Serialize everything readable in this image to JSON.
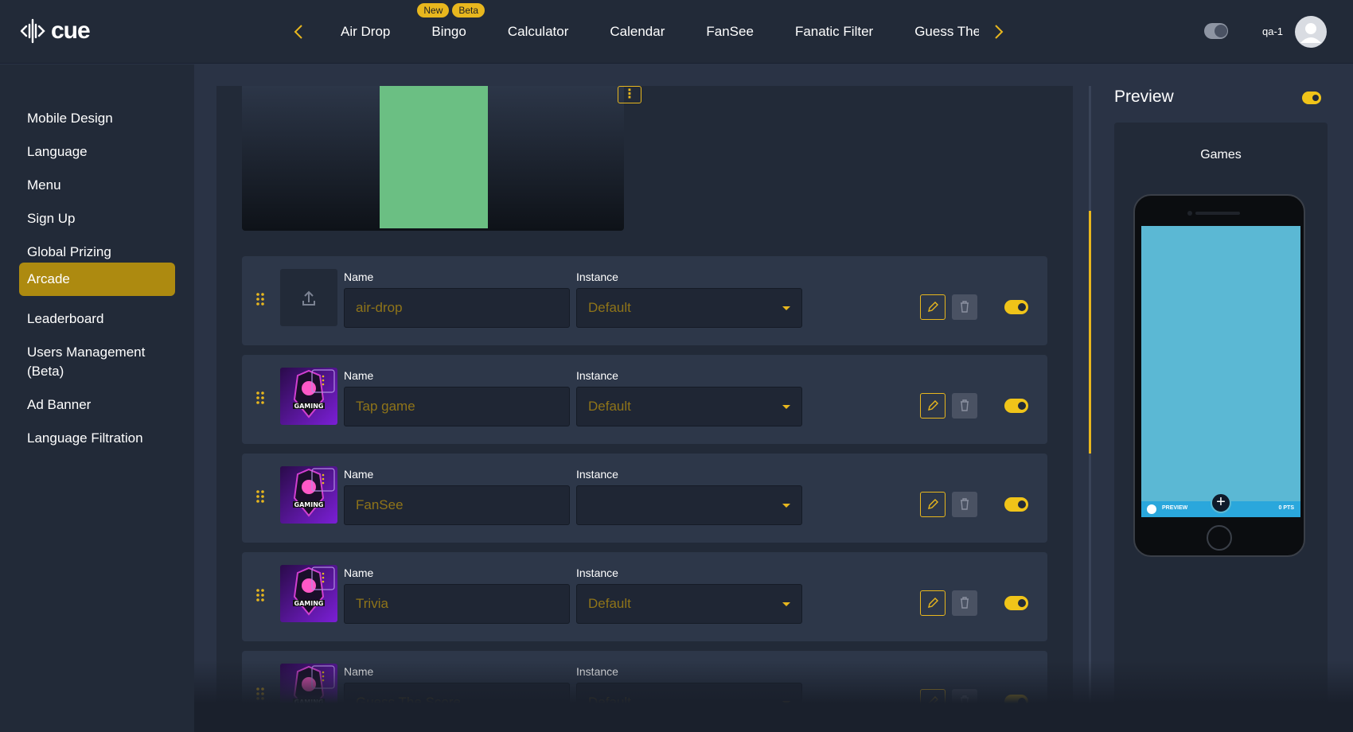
{
  "app": {
    "logo_text": "cue",
    "user_name": "qa-1"
  },
  "top_nav": {
    "tabs": [
      {
        "label": "Air Drop"
      },
      {
        "label": "Bingo",
        "badges": [
          "New",
          "Beta"
        ]
      },
      {
        "label": "Calculator"
      },
      {
        "label": "Calendar"
      },
      {
        "label": "FanSee"
      },
      {
        "label": "Fanatic Filter"
      },
      {
        "label": "Guess The"
      }
    ]
  },
  "sidebar": {
    "items": [
      {
        "label": "Mobile Design"
      },
      {
        "label": "Language"
      },
      {
        "label": "Menu"
      },
      {
        "label": "Sign Up"
      },
      {
        "label": "Global Prizing"
      },
      {
        "label": "Arcade",
        "active": true
      },
      {
        "label": "Leaderboard"
      },
      {
        "label": "Users Management (Beta)"
      },
      {
        "label": "Ad Banner"
      },
      {
        "label": "Language Filtration"
      }
    ]
  },
  "games": {
    "name_label": "Name",
    "instance_label": "Instance",
    "rows": [
      {
        "name": "air-drop",
        "instance": "Default",
        "thumbnail": "upload-icon",
        "enabled": true
      },
      {
        "name": "Tap game",
        "instance": "Default",
        "thumbnail": "gaming-logo",
        "enabled": true
      },
      {
        "name": "FanSee",
        "instance": "",
        "thumbnail": "gaming-logo",
        "enabled": true
      },
      {
        "name": "Trivia",
        "instance": "Default",
        "thumbnail": "gaming-logo",
        "enabled": true
      },
      {
        "name": "Guess The Score",
        "instance": "Default",
        "thumbnail": "gaming-logo",
        "enabled": true
      }
    ]
  },
  "preview": {
    "title": "Preview",
    "screen_title": "Games",
    "footer_left": "PREVIEW",
    "footer_right": "0 PTS",
    "enabled": true
  },
  "colors": {
    "accent": "#e8b71e",
    "sidebar_active": "#ad8a10",
    "banner_green": "#6bbf83",
    "phone_screen": "#5bb8d4"
  }
}
